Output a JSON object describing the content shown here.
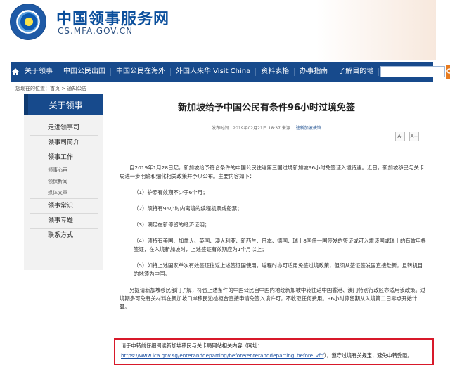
{
  "site": {
    "title": "中国领事服务网",
    "domain": "CS.MFA.GOV.CN"
  },
  "nav": {
    "home_icon": "home-icon",
    "items": [
      "关于领事",
      "中国公民出国",
      "中国公民在海外",
      "外国人来华 Visit China",
      "资料表格",
      "办事指南",
      "了解目的地"
    ],
    "search_placeholder": "",
    "search_icon": "search-icon"
  },
  "breadcrumb": "您现在的位置：首页 > 通知公告",
  "sidebar": {
    "title": "关于领事",
    "items": [
      {
        "label": "走进领事司",
        "sub": false
      },
      {
        "label": "领事司简介",
        "sub": false
      },
      {
        "label": "领事工作",
        "sub": false
      },
      {
        "label": "领事心声",
        "sub": true
      },
      {
        "label": "领保新闻",
        "sub": true
      },
      {
        "label": "媒体文章",
        "sub": true
      },
      {
        "label": "领事常识",
        "sub": false
      },
      {
        "label": "领事专题",
        "sub": false
      },
      {
        "label": "联系方式",
        "sub": false
      }
    ]
  },
  "article": {
    "title": "新加坡给予中国公民有条件96小时过境免签",
    "meta_date": "发布时间：2019年02月21日 18:37 来源：",
    "meta_source": "驻新加坡使馆",
    "font_smaller": "A-",
    "font_larger": "A+",
    "paragraphs": [
      "自2019年1月28日起，新加坡给予符合条件的中国公民往返第三国过境新加坡96小时免签证入境待遇。近日，新加坡移民与关卡局进一步明确和细化相关政策并予以公布。主要内容如下：",
      "（1）护照有效期不少于6个月；",
      "（2）须持有96小时内离境的续程机票或船票；",
      "（3）满足在新停留的经济证明；",
      "（4）须持有美国、加拿大、英国、澳大利亚、新西兰、日本、德国、瑞士8国任一国签发的签证或可入境该国或瑞士的有效申根签证，在入境新加坡时，上述签证有效期应为1个月以上；",
      "（5）如持上述国家单次有效签证往返上述签证国使用，返程时亦可适用免签过境政策，但须从签证签发国直接赴新，且转机目的地须为中国。",
      "另提请新加坡移民部门了解，符合上述条件的中国公民自中国内地经新加坡中转往返中国香港、澳门特别行政区亦适用该政策。过境期多可免有关材料在新加坡口岸移民边检柜台直接申请免签入境许可，不收取任何费用。96小时停留期从入境第二日零点开始计算。"
    ],
    "notice_text": "请于中转前仔细阅读新加坡移民与关卡局网站相关内容（网址：",
    "notice_url": "https://www.ica.gov.sg/enteranddeparting/before/enteranddeparting_before_vftf",
    "notice_tail": "），遵守过境有关规定，避免中转受阻。"
  }
}
